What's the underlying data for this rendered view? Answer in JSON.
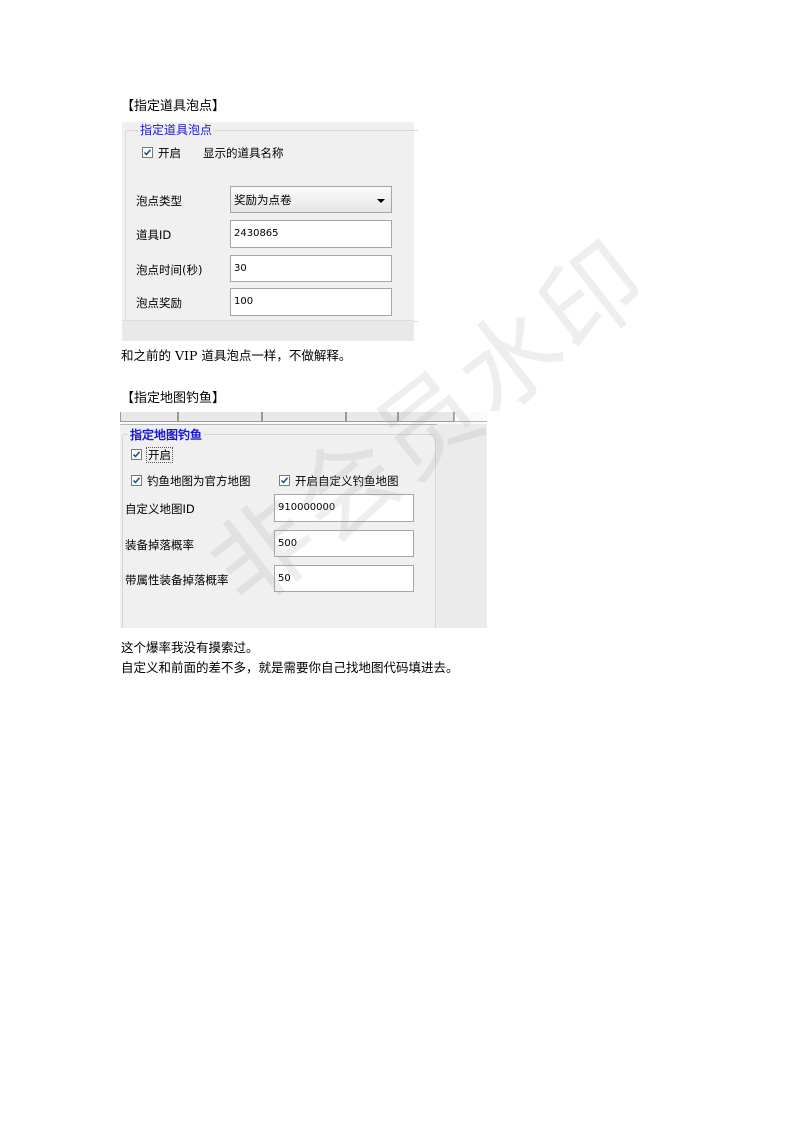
{
  "section1": {
    "heading": "【指定道具泡点】",
    "groupbox": {
      "legend": "指定道具泡点",
      "enable_label": "开启",
      "show_name_label": "显示的道具名称",
      "type_label": "泡点类型",
      "type_value": "奖励为点卷",
      "item_id_label": "道具ID",
      "item_id_value": "2430865",
      "time_label": "泡点时间(秒)",
      "time_value": "30",
      "reward_label": "泡点奖励",
      "reward_value": "100"
    },
    "note": "和之前的 VIP 道具泡点一样，不做解释。"
  },
  "section2": {
    "heading": "【指定地图钓鱼】",
    "groupbox": {
      "legend": "指定地图钓鱼",
      "enable_label": "开启",
      "official_map_label": "钓鱼地图为官方地图",
      "custom_map_label": "开启自定义钓鱼地图",
      "map_id_label": "自定义地图ID",
      "map_id_value": "910000000",
      "drop_rate_label": "装备掉落概率",
      "drop_rate_value": "500",
      "attr_drop_rate_label": "带属性装备掉落概率",
      "attr_drop_rate_value": "50"
    },
    "note1": "这个爆率我没有摸索过。",
    "note2": "自定义和前面的差不多，就是需要你自己找地图代码填进去。"
  },
  "watermark": "非会员水印"
}
